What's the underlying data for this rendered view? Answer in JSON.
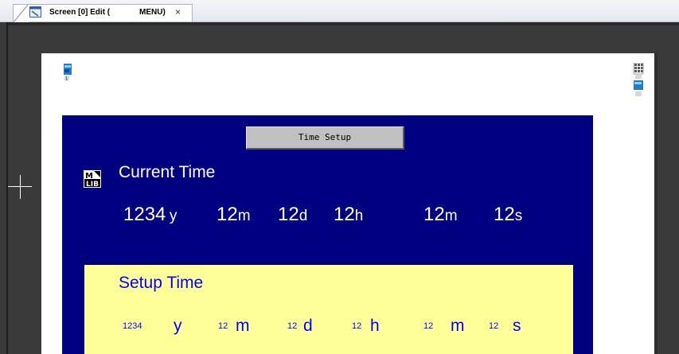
{
  "tab": {
    "title_left": "Screen [0] Edit (",
    "title_right": "MENU)",
    "close": "×"
  },
  "screen": {
    "button_label": "Time Setup",
    "mlib_badge": "M LIB",
    "current": {
      "title": "Current Time",
      "year": "1234",
      "year_unit": "y",
      "month": "12",
      "month_unit": "m",
      "day": "12",
      "day_unit": "d",
      "hour": "12",
      "hour_unit": "h",
      "minute": "12",
      "minute_unit": "m",
      "second": "12",
      "second_unit": "s"
    },
    "setup": {
      "title": "Setup Time",
      "year": "1234",
      "year_unit": "y",
      "month": "12",
      "month_unit": "m",
      "day": "12",
      "day_unit": "d",
      "hour": "12",
      "hour_unit": "h",
      "minute": "12",
      "minute_unit": "m",
      "second": "12",
      "second_unit": "s"
    }
  },
  "colors": {
    "panel_bg": "#000080",
    "setup_bg": "#ffff99",
    "setup_text": "#0000ff",
    "button_bg": "#c0c0c0",
    "workspace_bg": "#3a3a3a"
  }
}
